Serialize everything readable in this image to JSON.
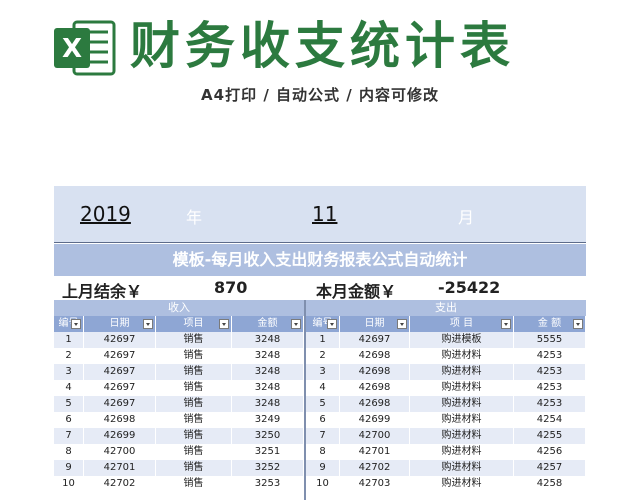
{
  "header": {
    "logo_letter": "X",
    "title": "财务收支统计表",
    "subtitle": "A4打印 / 自动公式 / 内容可修改"
  },
  "sheet": {
    "year": "2019",
    "year_unit": "年",
    "month": "11",
    "month_unit": "月",
    "report_title": "模板-每月收入支出财务报表公式自动统计",
    "last_balance_label": "上月结余￥",
    "last_balance_value": "870",
    "current_amount_label": "本月金额￥",
    "current_amount_value": "-25422",
    "income_label": "收入",
    "expense_label": "支出",
    "income_columns": [
      "编号",
      "日期",
      "项目",
      "金额"
    ],
    "expense_columns": [
      "编号",
      "日期",
      "项 目",
      "金 额"
    ],
    "income_rows": [
      [
        "1",
        "42697",
        "销售",
        "3248"
      ],
      [
        "2",
        "42697",
        "销售",
        "3248"
      ],
      [
        "3",
        "42697",
        "销售",
        "3248"
      ],
      [
        "4",
        "42697",
        "销售",
        "3248"
      ],
      [
        "5",
        "42697",
        "销售",
        "3248"
      ],
      [
        "6",
        "42698",
        "销售",
        "3249"
      ],
      [
        "7",
        "42699",
        "销售",
        "3250"
      ],
      [
        "8",
        "42700",
        "销售",
        "3251"
      ],
      [
        "9",
        "42701",
        "销售",
        "3252"
      ],
      [
        "10",
        "42702",
        "销售",
        "3253"
      ]
    ],
    "expense_rows": [
      [
        "1",
        "42697",
        "购进模板",
        "5555"
      ],
      [
        "2",
        "42698",
        "购进材料",
        "4253"
      ],
      [
        "3",
        "42698",
        "购进材料",
        "4253"
      ],
      [
        "4",
        "42698",
        "购进材料",
        "4253"
      ],
      [
        "5",
        "42698",
        "购进材料",
        "4253"
      ],
      [
        "6",
        "42699",
        "购进材料",
        "4254"
      ],
      [
        "7",
        "42700",
        "购进材料",
        "4255"
      ],
      [
        "8",
        "42701",
        "购进材料",
        "4256"
      ],
      [
        "9",
        "42702",
        "购进材料",
        "4257"
      ],
      [
        "10",
        "42703",
        "购进材料",
        "4258"
      ]
    ],
    "colors": {
      "brand_green": "#2c7a3f",
      "date_band": "#d8e1f1",
      "title_band": "#aebfe0",
      "column_header": "#8ea6d4",
      "row_light": "#e6ebf6",
      "row_white": "#ffffff"
    }
  }
}
